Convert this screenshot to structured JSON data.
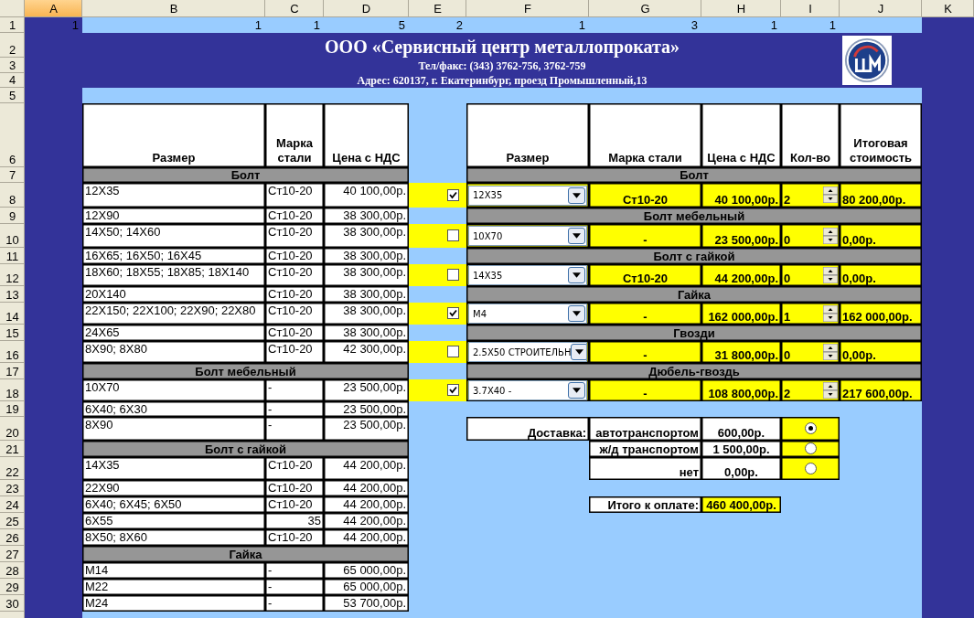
{
  "column_headers": [
    {
      "label": "A",
      "selected": true
    },
    {
      "label": "B",
      "selected": false
    },
    {
      "label": "C",
      "selected": false
    },
    {
      "label": "D",
      "selected": false
    },
    {
      "label": "E",
      "selected": false
    },
    {
      "label": "F",
      "selected": false
    },
    {
      "label": "G",
      "selected": false
    },
    {
      "label": "H",
      "selected": false
    },
    {
      "label": "I",
      "selected": false
    },
    {
      "label": "J",
      "selected": false
    },
    {
      "label": "K",
      "selected": false
    }
  ],
  "row_numbers": [
    "1",
    "2",
    "3",
    "4",
    "5",
    "6",
    "7",
    "8",
    "9",
    "10",
    "11",
    "12",
    "13",
    "14",
    "15",
    "16",
    "17",
    "18",
    "19",
    "20",
    "21",
    "22",
    "23",
    "24",
    "25",
    "26",
    "27",
    "28",
    "29",
    "30"
  ],
  "row_1_values": [
    "1",
    "1",
    "1",
    "5",
    "2",
    "1",
    "3",
    "1",
    "1"
  ],
  "header": {
    "company": "ООО «Сервисный центр металлопроката»",
    "phone": "Тел/факс: (343) 3762-756, 3762-759",
    "address": "Адрес: 620137, г. Екатеринбург, проезд Промышленный,13"
  },
  "price_list": {
    "columns": [
      "Размер",
      "Марка стали",
      "Цена с НДС"
    ],
    "sections": [
      {
        "title": "Болт",
        "rows": [
          {
            "size": "12X35",
            "steel": "Ст10-20",
            "price": "40 100,00р."
          },
          {
            "size": "12X90",
            "steel": "Ст10-20",
            "price": "38 300,00р."
          },
          {
            "size": "14X50; 14X60",
            "steel": "Ст10-20",
            "price": "38 300,00р."
          },
          {
            "size": "16X65; 16X50; 16X45",
            "steel": "Ст10-20",
            "price": "38 300,00р."
          },
          {
            "size": "18X60; 18X55; 18X85; 18X140",
            "steel": "Ст10-20",
            "price": "38 300,00р."
          },
          {
            "size": "20X140",
            "steel": "Ст10-20",
            "price": "38 300,00р."
          },
          {
            "size": "22X150; 22X100; 22X90; 22X80",
            "steel": "Ст10-20",
            "price": "38 300,00р."
          },
          {
            "size": "24X65",
            "steel": "Ст10-20",
            "price": "38 300,00р."
          },
          {
            "size": "8X90; 8X80",
            "steel": "Ст10-20",
            "price": "42 300,00р."
          }
        ]
      },
      {
        "title": "Болт мебельный",
        "rows": [
          {
            "size": "10X70",
            "steel": "-",
            "price": "23 500,00р."
          },
          {
            "size": "6X40; 6X30",
            "steel": "-",
            "price": "23 500,00р."
          },
          {
            "size": "8X90",
            "steel": "-",
            "price": "23 500,00р."
          }
        ]
      },
      {
        "title": "Болт с гайкой",
        "rows": [
          {
            "size": "14X35",
            "steel": "Ст10-20",
            "price": "44 200,00р."
          },
          {
            "size": "22X90",
            "steel": "Ст10-20",
            "price": "44 200,00р."
          },
          {
            "size": "6X40; 6X45; 6X50",
            "steel": "Ст10-20",
            "price": "44 200,00р."
          },
          {
            "size": "6X55",
            "steel": "35",
            "price": "44 200,00р.",
            "kind": "number"
          },
          {
            "size": "8X50; 8X60",
            "steel": "Ст10-20",
            "price": "44 200,00р."
          }
        ]
      },
      {
        "title": "Гайка",
        "rows": [
          {
            "size": "M14",
            "steel": "-",
            "price": "65 000,00р."
          },
          {
            "size": "M22",
            "steel": "-",
            "price": "65 000,00р."
          },
          {
            "size": "M24",
            "steel": "-",
            "price": "53 700,00р."
          }
        ]
      }
    ]
  },
  "order": {
    "columns": [
      "Размер",
      "Марка стали",
      "Цена с НДС",
      "Кол-во",
      "Итоговая стоимость"
    ],
    "items": [
      {
        "title": "Болт",
        "checked": true,
        "size": "12X35",
        "steel": "Ст10-20",
        "price": "40 100,00р.",
        "quantity": "2",
        "total": "80 200,00р."
      },
      {
        "title": "Болт мебельный",
        "checked": false,
        "size": "10X70",
        "steel": "-",
        "price": "23 500,00р.",
        "quantity": "0",
        "total": "0,00р."
      },
      {
        "title": "Болт с гайкой",
        "checked": false,
        "size": "14X35",
        "steel": "Ст10-20",
        "price": "44 200,00р.",
        "quantity": "0",
        "total": "0,00р."
      },
      {
        "title": "Гайка",
        "checked": true,
        "size": "M4",
        "steel": "-",
        "price": "162 000,00р.",
        "quantity": "1",
        "total": "162 000,00р."
      },
      {
        "title": "Гвозди",
        "checked": false,
        "size": "2.5X50 СТРОИТЕЛЬН",
        "steel": "-",
        "price": "31 800,00р.",
        "quantity": "0",
        "total": "0,00р."
      },
      {
        "title": "Дюбель-гвоздь",
        "checked": true,
        "size": "3.7X40 -",
        "steel": "-",
        "price": "108 800,00р.",
        "quantity": "2",
        "total": "217 600,00р."
      }
    ]
  },
  "delivery": {
    "label": "Доставка:",
    "options": [
      {
        "name": "автотранспортом",
        "price": "600,00р.",
        "selected": true
      },
      {
        "name": "ж/д транспортом",
        "price": "1 500,00р.",
        "selected": false
      },
      {
        "name": "нет",
        "price": "0,00р.",
        "selected": false
      }
    ]
  },
  "total": {
    "label": "Итого к оплате:",
    "value": "460 400,00р."
  }
}
